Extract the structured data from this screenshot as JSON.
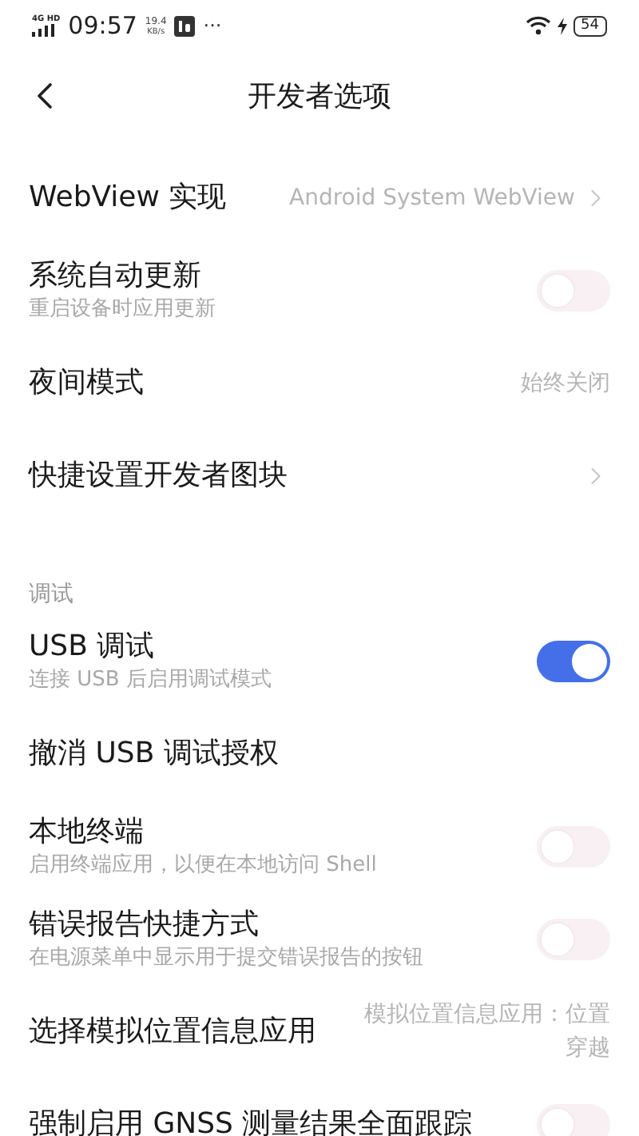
{
  "status_bar": {
    "network": "4G HD",
    "time": "09:57",
    "speed_value": "19.4",
    "speed_unit": "KB/s",
    "more": "···",
    "battery": "54"
  },
  "header": {
    "title": "开发者选项"
  },
  "items": [
    {
      "kind": "link",
      "title": "WebView 实现",
      "value": "Android System WebView"
    },
    {
      "kind": "switch",
      "title": "系统自动更新",
      "subtitle": "重启设备时应用更新",
      "on": false
    },
    {
      "kind": "value",
      "title": "夜间模式",
      "value": "始终关闭"
    },
    {
      "kind": "link",
      "title": "快捷设置开发者图块"
    },
    {
      "kind": "section",
      "title": "调试"
    },
    {
      "kind": "switch",
      "title": "USB 调试",
      "subtitle": "连接 USB 后启用调试模式",
      "on": true
    },
    {
      "kind": "plain",
      "title": "撤消 USB 调试授权"
    },
    {
      "kind": "switch",
      "title": "本地终端",
      "subtitle": "启用终端应用，以便在本地访问 Shell",
      "on": false
    },
    {
      "kind": "switch",
      "title": "错误报告快捷方式",
      "subtitle": "在电源菜单中显示用于提交错误报告的按钮",
      "on": false
    },
    {
      "kind": "value",
      "title": "选择模拟位置信息应用",
      "value": "模拟位置信息应用：位置穿越"
    },
    {
      "kind": "switch",
      "title": "强制启用 GNSS 测量结果全面跟踪",
      "on": false
    }
  ]
}
